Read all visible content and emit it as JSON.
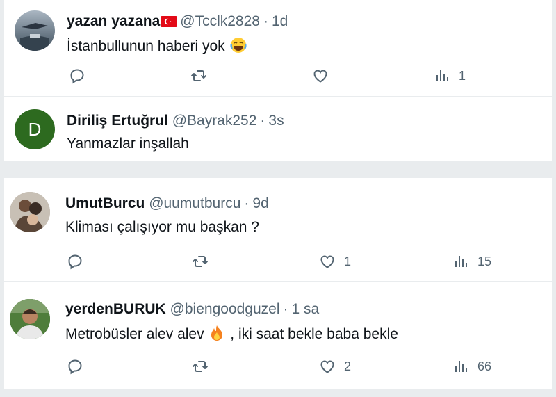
{
  "tweets": [
    {
      "name": "yazan yazana",
      "handle": "@Tcclk2828",
      "time": "1d",
      "text": "İstanbullunun haberi yok",
      "replies": "",
      "retweets": "",
      "likes": "",
      "views": "1"
    },
    {
      "name": "Diriliş Ertuğrul",
      "handle": "@Bayrak252",
      "time": "3s",
      "text": "Yanmazlar inşallah",
      "avatar_letter": "D"
    },
    {
      "name": "UmutBurcu",
      "handle": "@uumutburcu",
      "time": "9d",
      "text": "Kliması çalışıyor mu başkan ?",
      "replies": "",
      "retweets": "",
      "likes": "1",
      "views": "15"
    },
    {
      "name": "yerdenBURUK",
      "handle": "@biengoodguzel",
      "time": "1 sa",
      "text_before": "Metrobüsler alev alev",
      "text_after": " , iki saat bekle baba bekle",
      "replies": "",
      "retweets": "",
      "likes": "2",
      "views": "66"
    }
  ],
  "separator": "·",
  "colors": {
    "avatar_d": "#2d6a1f",
    "flag": "#e30a17",
    "secondary_text": "#536471"
  },
  "icons": [
    "reply-icon",
    "retweet-icon",
    "like-icon",
    "views-icon",
    "flag-turkey-icon",
    "laughing-emoji-icon",
    "fire-emoji-icon"
  ]
}
